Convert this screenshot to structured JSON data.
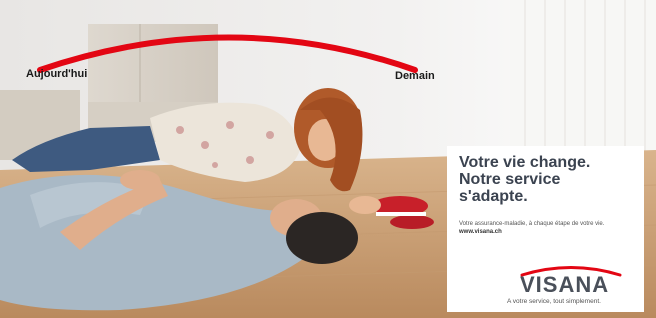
{
  "timeline": {
    "start_label": "Aujourd'hui",
    "end_label": "Demain",
    "arc_color": "#e30613"
  },
  "ad_panel": {
    "headline_line1": "Votre vie change.",
    "headline_line2": "Notre service",
    "headline_line3": "s'adapte.",
    "body_text": "Votre assurance-maladie, à chaque étape de votre vie.",
    "url": "www.visana.ch",
    "brand_name": "VISANA",
    "tagline": "A votre service, tout simplement.",
    "brand_color": "#e30613"
  }
}
